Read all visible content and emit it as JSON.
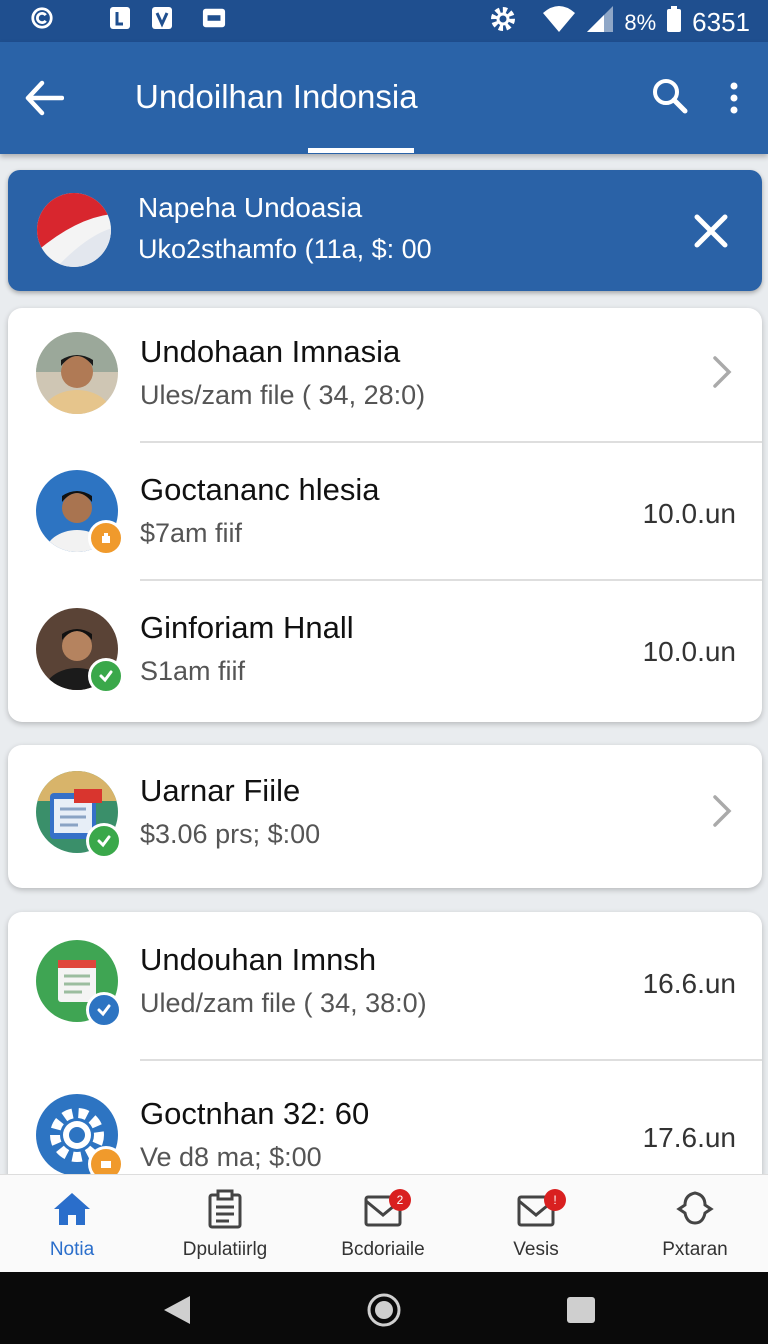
{
  "status_bar": {
    "battery_percent": "8%",
    "time": "6351",
    "left_icons": [
      "copyright-icon",
      "app-icon",
      "shield-icon",
      "keyboard-icon"
    ],
    "right_icons": [
      "settings-icon",
      "wifi-icon",
      "signal-icon",
      "battery-icon"
    ]
  },
  "app_bar": {
    "title": "Undoilhan Indonsia",
    "icons": [
      "back-arrow-icon",
      "search-icon",
      "more-vert-icon"
    ],
    "accent": "#2a63a8"
  },
  "notification": {
    "title": "Napeha Undoasia",
    "subtitle": "Uko2sthamfo (11a, $: 00",
    "close_icon": "close-icon",
    "background": "#2a62a7"
  },
  "cards": [
    {
      "rows": [
        {
          "title": "Undohaan Imnasia",
          "subtitle": "Ules/zam file  ( 34, 28:0)",
          "value": "",
          "chevron": true,
          "avatar": "person",
          "badge": ""
        },
        {
          "title": "Goctananc hlesia",
          "subtitle": "$7am fiif",
          "value": "10.0.un",
          "chevron": false,
          "avatar": "person",
          "badge": "orange"
        },
        {
          "title": "Ginforiam Hnall",
          "subtitle": "S1am fiif",
          "value": "10.0.un",
          "chevron": false,
          "avatar": "person",
          "badge": "green"
        }
      ]
    },
    {
      "rows": [
        {
          "title": "Uarnar Fiile",
          "subtitle": "$3.06  prs; $:00",
          "value": "",
          "chevron": true,
          "avatar": "document",
          "badge": "green"
        }
      ]
    },
    {
      "rows": [
        {
          "title": "Undouhan Imnsh",
          "subtitle": "Uled/zam file  ( 34, 38:0)",
          "value": "16.6.un",
          "chevron": false,
          "avatar": "document-green",
          "badge": "blue"
        },
        {
          "title": "Goctnhan 32: 60",
          "subtitle": "Ve d8  ma; $:00",
          "value": "17.6.un",
          "chevron": false,
          "avatar": "gear",
          "badge": "orange"
        }
      ]
    }
  ],
  "bottom_nav": [
    {
      "label": "Notia",
      "icon": "home-icon",
      "active": true,
      "badge": ""
    },
    {
      "label": "Dpulatiirlg",
      "icon": "clipboard-icon",
      "active": false,
      "badge": ""
    },
    {
      "label": "Bcdoriaile",
      "icon": "inbox-icon",
      "active": false,
      "badge": "2"
    },
    {
      "label": "Vesis",
      "icon": "inbox-icon",
      "active": false,
      "badge": "!"
    },
    {
      "label": "Pxtaran",
      "icon": "profile-icon",
      "active": false,
      "badge": ""
    }
  ],
  "system_nav": [
    "back-triangle-icon",
    "home-circle-icon",
    "recents-square-icon"
  ]
}
